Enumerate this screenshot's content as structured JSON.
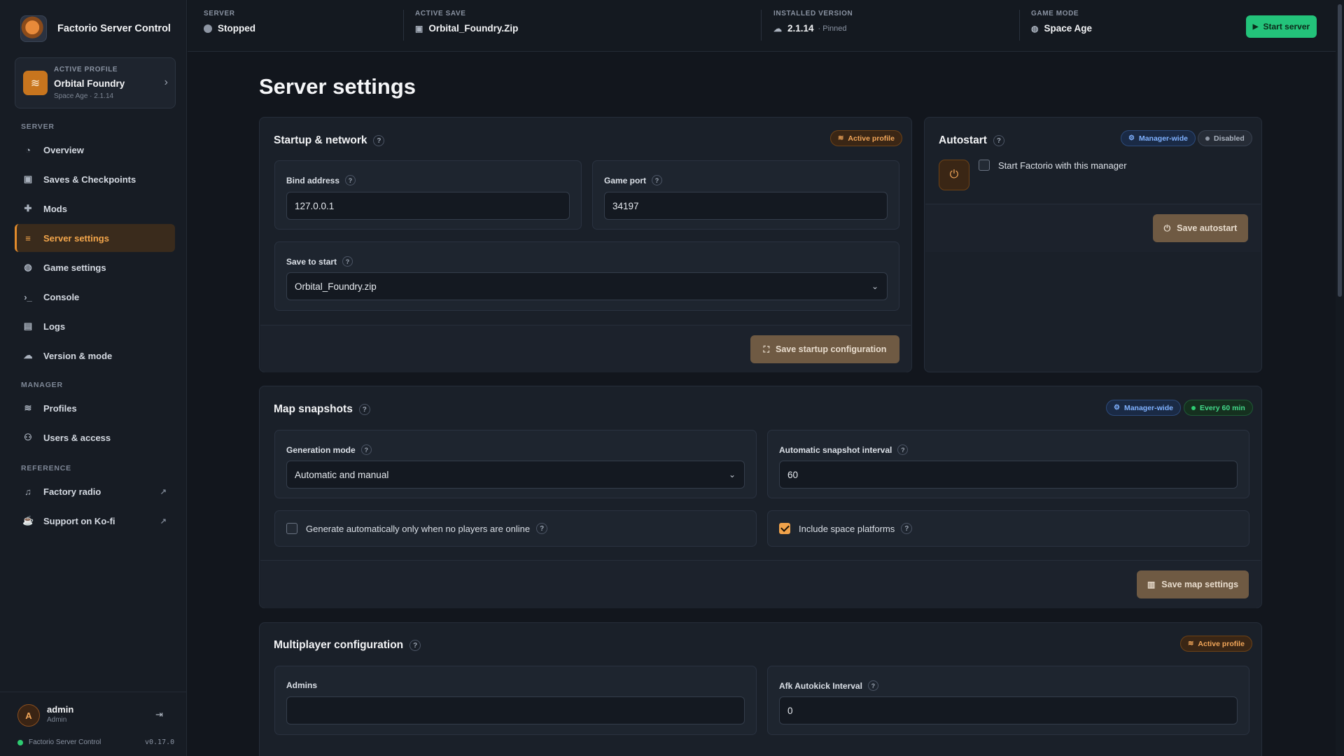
{
  "app": {
    "name": "Factorio Server Control"
  },
  "profile": {
    "kicker": "ACTIVE PROFILE",
    "name": "Orbital Foundry",
    "sub": "Space Age · 2.1.14"
  },
  "nav": {
    "server_title": "SERVER",
    "manager_title": "MANAGER",
    "reference_title": "REFERENCE",
    "items": [
      {
        "label": "Overview",
        "icon": "gauge-icon"
      },
      {
        "label": "Saves & Checkpoints",
        "icon": "floppy-icon"
      },
      {
        "label": "Mods",
        "icon": "puzzle-icon"
      },
      {
        "label": "Server settings",
        "icon": "sliders-icon"
      },
      {
        "label": "Game settings",
        "icon": "gamepad-icon"
      },
      {
        "label": "Console",
        "icon": "terminal-icon"
      },
      {
        "label": "Logs",
        "icon": "file-icon"
      },
      {
        "label": "Version & mode",
        "icon": "cloud-icon"
      },
      {
        "label": "Profiles",
        "icon": "layers-icon"
      },
      {
        "label": "Users & access",
        "icon": "users-icon"
      },
      {
        "label": "Factory radio",
        "icon": "music-icon"
      },
      {
        "label": "Support on Ko-fi",
        "icon": "mug-icon"
      }
    ]
  },
  "user": {
    "initial": "A",
    "name": "admin",
    "role": "Admin"
  },
  "footer": {
    "app": "Factorio Server Control",
    "version": "v0.17.0"
  },
  "topbar": {
    "server_kicker": "SERVER",
    "server_value": "Stopped",
    "save_kicker": "ACTIVE SAVE",
    "save_value": "Orbital_Foundry.Zip",
    "version_kicker": "INSTALLED VERSION",
    "version_value": "2.1.14",
    "version_note": "· Pinned",
    "mode_kicker": "GAME MODE",
    "mode_value": "Space Age",
    "start_label": "Start server"
  },
  "page": {
    "title": "Server settings"
  },
  "startup": {
    "title": "Startup & network",
    "badge": "Active profile",
    "bind_label": "Bind address",
    "bind_value": "127.0.0.1",
    "port_label": "Game port",
    "port_value": "34197",
    "save_label": "Save to start",
    "save_value": "Orbital_Foundry.zip",
    "button": "Save startup configuration"
  },
  "autostart": {
    "title": "Autostart",
    "badge_manager": "Manager-wide",
    "badge_status": "Disabled",
    "checkbox_label": "Start Factorio with this manager",
    "checked": false,
    "button": "Save autostart"
  },
  "snapshots": {
    "title": "Map snapshots",
    "badge_manager": "Manager-wide",
    "badge_interval": "Every 60 min",
    "mode_label": "Generation mode",
    "mode_value": "Automatic and manual",
    "interval_label": "Automatic snapshot interval",
    "interval_value": "60",
    "offline_label": "Generate automatically only when no players are online",
    "offline_checked": false,
    "platforms_label": "Include space platforms",
    "platforms_checked": true,
    "button": "Save map settings"
  },
  "multiplayer": {
    "title": "Multiplayer configuration",
    "badge": "Active profile",
    "admins_label": "Admins",
    "admins_value": "",
    "afk_label": "Afk Autokick Interval",
    "afk_value": "0"
  },
  "colors": {
    "accent": "#e28b2c",
    "start": "#23c37a",
    "bg": "#12161d"
  }
}
